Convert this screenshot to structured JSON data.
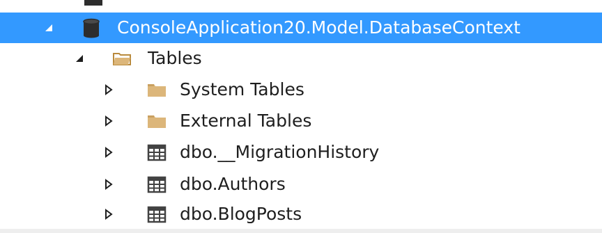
{
  "theme": {
    "selection": "#3399ff",
    "bar": "#eeeeee",
    "folder": "#dcb67a",
    "folder_dark": "#b98a3d",
    "grid": "#424242",
    "db": "#2d2d2d"
  },
  "tree": {
    "database": {
      "label": "ConsoleApplication20.Model.DatabaseContext",
      "icon": "database-icon",
      "expanded": true,
      "selected": true
    },
    "tables_folder": {
      "label": "Tables",
      "icon": "folder-open-icon",
      "expanded": true
    },
    "items": [
      {
        "label": "System Tables",
        "icon": "folder-icon",
        "expanded": false
      },
      {
        "label": "External Tables",
        "icon": "folder-icon",
        "expanded": false
      },
      {
        "label": "dbo.__MigrationHistory",
        "icon": "table-icon",
        "expanded": false
      },
      {
        "label": "dbo.Authors",
        "icon": "table-icon",
        "expanded": false
      },
      {
        "label": "dbo.BlogPosts",
        "icon": "table-icon",
        "expanded": false
      }
    ]
  }
}
